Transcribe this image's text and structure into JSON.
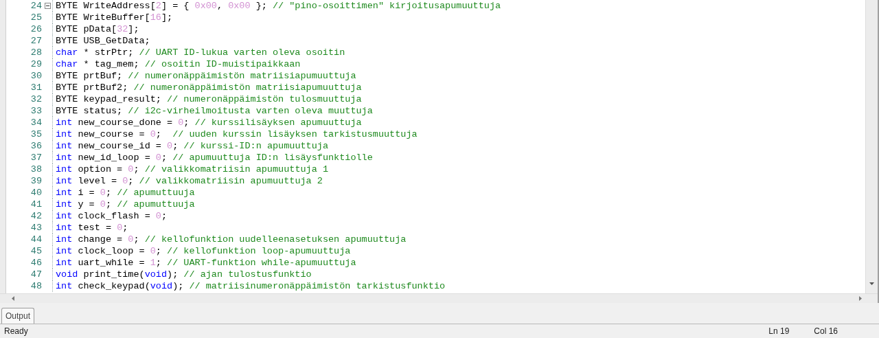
{
  "editor": {
    "lines": [
      {
        "number": "24",
        "fold": true,
        "tokens": [
          {
            "kind": "plain",
            "text": "BYTE WriteAddress["
          },
          {
            "kind": "number",
            "text": "2"
          },
          {
            "kind": "plain",
            "text": "] = { "
          },
          {
            "kind": "number",
            "text": "0x00"
          },
          {
            "kind": "plain",
            "text": ", "
          },
          {
            "kind": "number",
            "text": "0x00"
          },
          {
            "kind": "plain",
            "text": " }; "
          },
          {
            "kind": "comment",
            "text": "// \"pino-osoittimen\" kirjoitusapumuuttuja"
          }
        ]
      },
      {
        "number": "25",
        "fold": false,
        "tokens": [
          {
            "kind": "plain",
            "text": "BYTE WriteBuffer["
          },
          {
            "kind": "number",
            "text": "16"
          },
          {
            "kind": "plain",
            "text": "];"
          }
        ]
      },
      {
        "number": "26",
        "fold": false,
        "tokens": [
          {
            "kind": "plain",
            "text": "BYTE pData["
          },
          {
            "kind": "number",
            "text": "32"
          },
          {
            "kind": "plain",
            "text": "];"
          }
        ]
      },
      {
        "number": "27",
        "fold": false,
        "tokens": [
          {
            "kind": "plain",
            "text": "BYTE USB_GetData;"
          }
        ]
      },
      {
        "number": "28",
        "fold": false,
        "tokens": [
          {
            "kind": "keyword",
            "text": "char"
          },
          {
            "kind": "plain",
            "text": " * strPtr; "
          },
          {
            "kind": "comment",
            "text": "// UART ID-lukua varten oleva osoitin"
          }
        ]
      },
      {
        "number": "29",
        "fold": false,
        "tokens": [
          {
            "kind": "keyword",
            "text": "char"
          },
          {
            "kind": "plain",
            "text": " * tag_mem; "
          },
          {
            "kind": "comment",
            "text": "// osoitin ID-muistipaikkaan"
          }
        ]
      },
      {
        "number": "30",
        "fold": false,
        "tokens": [
          {
            "kind": "plain",
            "text": "BYTE prtBuf; "
          },
          {
            "kind": "comment",
            "text": "// numeronäppäimistön matriisiapumuuttuja"
          }
        ]
      },
      {
        "number": "31",
        "fold": false,
        "tokens": [
          {
            "kind": "plain",
            "text": "BYTE prtBuf2; "
          },
          {
            "kind": "comment",
            "text": "// numeronäppäimistön matriisiapumuuttuja"
          }
        ]
      },
      {
        "number": "32",
        "fold": false,
        "tokens": [
          {
            "kind": "plain",
            "text": "BYTE keypad_result; "
          },
          {
            "kind": "comment",
            "text": "// numeronäppäimistön tulosmuuttuja"
          }
        ]
      },
      {
        "number": "33",
        "fold": false,
        "tokens": [
          {
            "kind": "plain",
            "text": "BYTE status; "
          },
          {
            "kind": "comment",
            "text": "// i2c-virheilmoitusta varten oleva muuttuja"
          }
        ]
      },
      {
        "number": "34",
        "fold": false,
        "tokens": [
          {
            "kind": "keyword",
            "text": "int"
          },
          {
            "kind": "plain",
            "text": " new_course_done = "
          },
          {
            "kind": "number",
            "text": "0"
          },
          {
            "kind": "plain",
            "text": "; "
          },
          {
            "kind": "comment",
            "text": "// kurssilisäyksen apumuuttuja"
          }
        ]
      },
      {
        "number": "35",
        "fold": false,
        "tokens": [
          {
            "kind": "keyword",
            "text": "int"
          },
          {
            "kind": "plain",
            "text": " new_course = "
          },
          {
            "kind": "number",
            "text": "0"
          },
          {
            "kind": "plain",
            "text": ";  "
          },
          {
            "kind": "comment",
            "text": "// uuden kurssin lisäyksen tarkistusmuuttuja"
          }
        ]
      },
      {
        "number": "36",
        "fold": false,
        "tokens": [
          {
            "kind": "keyword",
            "text": "int"
          },
          {
            "kind": "plain",
            "text": " new_course_id = "
          },
          {
            "kind": "number",
            "text": "0"
          },
          {
            "kind": "plain",
            "text": "; "
          },
          {
            "kind": "comment",
            "text": "// kurssi-ID:n apumuuttuja"
          }
        ]
      },
      {
        "number": "37",
        "fold": false,
        "tokens": [
          {
            "kind": "keyword",
            "text": "int"
          },
          {
            "kind": "plain",
            "text": " new_id_loop = "
          },
          {
            "kind": "number",
            "text": "0"
          },
          {
            "kind": "plain",
            "text": "; "
          },
          {
            "kind": "comment",
            "text": "// apumuuttuja ID:n lisäysfunktiolle"
          }
        ]
      },
      {
        "number": "38",
        "fold": false,
        "tokens": [
          {
            "kind": "keyword",
            "text": "int"
          },
          {
            "kind": "plain",
            "text": " option = "
          },
          {
            "kind": "number",
            "text": "0"
          },
          {
            "kind": "plain",
            "text": "; "
          },
          {
            "kind": "comment",
            "text": "// valikkomatriisin apumuuttuja 1"
          }
        ]
      },
      {
        "number": "39",
        "fold": false,
        "tokens": [
          {
            "kind": "keyword",
            "text": "int"
          },
          {
            "kind": "plain",
            "text": " level = "
          },
          {
            "kind": "number",
            "text": "0"
          },
          {
            "kind": "plain",
            "text": "; "
          },
          {
            "kind": "comment",
            "text": "// valikkomatriisin apumuuttuja 2"
          }
        ]
      },
      {
        "number": "40",
        "fold": false,
        "tokens": [
          {
            "kind": "keyword",
            "text": "int"
          },
          {
            "kind": "plain",
            "text": " i = "
          },
          {
            "kind": "number",
            "text": "0"
          },
          {
            "kind": "plain",
            "text": "; "
          },
          {
            "kind": "comment",
            "text": "// apumuttuuja"
          }
        ]
      },
      {
        "number": "41",
        "fold": false,
        "tokens": [
          {
            "kind": "keyword",
            "text": "int"
          },
          {
            "kind": "plain",
            "text": " y = "
          },
          {
            "kind": "number",
            "text": "0"
          },
          {
            "kind": "plain",
            "text": "; "
          },
          {
            "kind": "comment",
            "text": "// apumuttuuja"
          }
        ]
      },
      {
        "number": "42",
        "fold": false,
        "tokens": [
          {
            "kind": "keyword",
            "text": "int"
          },
          {
            "kind": "plain",
            "text": " clock_flash = "
          },
          {
            "kind": "number",
            "text": "0"
          },
          {
            "kind": "plain",
            "text": ";"
          }
        ]
      },
      {
        "number": "43",
        "fold": false,
        "tokens": [
          {
            "kind": "keyword",
            "text": "int"
          },
          {
            "kind": "plain",
            "text": " test = "
          },
          {
            "kind": "number",
            "text": "0"
          },
          {
            "kind": "plain",
            "text": ";"
          }
        ]
      },
      {
        "number": "44",
        "fold": false,
        "tokens": [
          {
            "kind": "keyword",
            "text": "int"
          },
          {
            "kind": "plain",
            "text": " change = "
          },
          {
            "kind": "number",
            "text": "0"
          },
          {
            "kind": "plain",
            "text": "; "
          },
          {
            "kind": "comment",
            "text": "// kellofunktion uudelleenasetuksen apumuuttuja"
          }
        ]
      },
      {
        "number": "45",
        "fold": false,
        "tokens": [
          {
            "kind": "keyword",
            "text": "int"
          },
          {
            "kind": "plain",
            "text": " clock_loop = "
          },
          {
            "kind": "number",
            "text": "0"
          },
          {
            "kind": "plain",
            "text": "; "
          },
          {
            "kind": "comment",
            "text": "// kellofunktion loop-apumuuttuja"
          }
        ]
      },
      {
        "number": "46",
        "fold": false,
        "tokens": [
          {
            "kind": "keyword",
            "text": "int"
          },
          {
            "kind": "plain",
            "text": " uart_while = "
          },
          {
            "kind": "number",
            "text": "1"
          },
          {
            "kind": "plain",
            "text": "; "
          },
          {
            "kind": "comment",
            "text": "// UART-funktion while-apumuuttuja"
          }
        ]
      },
      {
        "number": "47",
        "fold": false,
        "tokens": [
          {
            "kind": "keyword",
            "text": "void"
          },
          {
            "kind": "plain",
            "text": " print_time("
          },
          {
            "kind": "keyword",
            "text": "void"
          },
          {
            "kind": "plain",
            "text": "); "
          },
          {
            "kind": "comment",
            "text": "// ajan tulostusfunktio"
          }
        ]
      },
      {
        "number": "48",
        "fold": false,
        "tokens": [
          {
            "kind": "keyword",
            "text": "int"
          },
          {
            "kind": "plain",
            "text": " check_keypad("
          },
          {
            "kind": "keyword",
            "text": "void"
          },
          {
            "kind": "plain",
            "text": "); "
          },
          {
            "kind": "comment",
            "text": "// matriisinumeronäppäimistön tarkistusfunktio"
          }
        ]
      }
    ]
  },
  "panel_tabs": [
    {
      "label": "Output",
      "selected": true
    }
  ],
  "status_bar": {
    "message": "Ready",
    "line": "Ln 19",
    "column": "Col 16"
  }
}
